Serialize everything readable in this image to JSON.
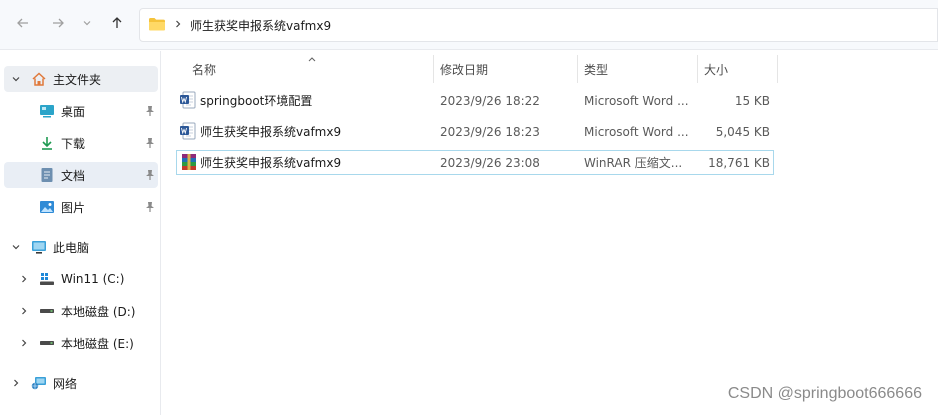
{
  "address": {
    "path_label": "师生获奖申报系统vafmx9"
  },
  "toolbar": {
    "back_icon": "arrow-left-icon",
    "forward_icon": "arrow-right-icon",
    "recent_icon": "chevron-down-icon",
    "up_icon": "arrow-up-icon"
  },
  "sidebar": {
    "home": {
      "label": "主文件夹",
      "icon": "home-icon"
    },
    "quick": [
      {
        "label": "桌面",
        "icon": "desktop-icon"
      },
      {
        "label": "下载",
        "icon": "download-icon"
      },
      {
        "label": "文档",
        "icon": "document-icon"
      },
      {
        "label": "图片",
        "icon": "pictures-icon"
      }
    ],
    "this_pc": {
      "label": "此电脑",
      "icon": "monitor-icon"
    },
    "drives": [
      {
        "label": "Win11 (C:)",
        "icon": "windows-drive-icon"
      },
      {
        "label": "本地磁盘 (D:)",
        "icon": "drive-icon"
      },
      {
        "label": "本地磁盘 (E:)",
        "icon": "drive-icon"
      }
    ],
    "network": {
      "label": "网络",
      "icon": "network-icon"
    }
  },
  "columns": {
    "name": "名称",
    "date": "修改日期",
    "type": "类型",
    "size": "大小"
  },
  "files": [
    {
      "name": "springboot环境配置",
      "date": "2023/9/26 18:22",
      "type": "Microsoft Word ...",
      "size": "15 KB",
      "icon": "word-doc-icon"
    },
    {
      "name": "师生获奖申报系统vafmx9",
      "date": "2023/9/26 18:23",
      "type": "Microsoft Word ...",
      "size": "5,045 KB",
      "icon": "word-doc-icon"
    },
    {
      "name": "师生获奖申报系统vafmx9",
      "date": "2023/9/26 23:08",
      "type": "WinRAR 压缩文...",
      "size": "18,761 KB",
      "icon": "winrar-archive-icon"
    }
  ],
  "watermark": "CSDN @springboot666666",
  "colors": {
    "accent": "#0067c0",
    "selection": "#e9eef5",
    "selected_border": "#a8d8ec"
  }
}
